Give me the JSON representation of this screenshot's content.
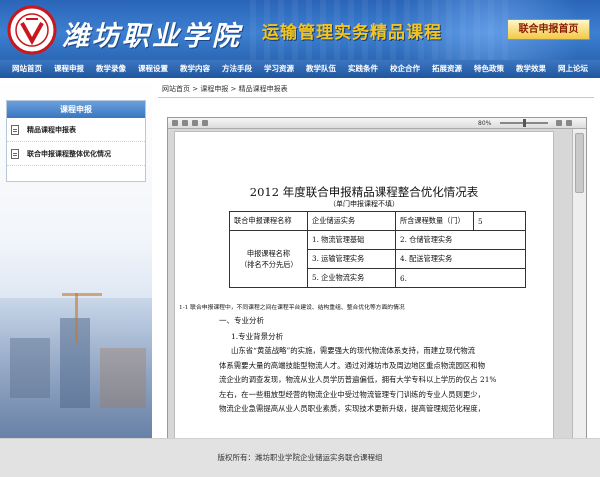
{
  "header": {
    "school_name": "潍坊职业学院",
    "course_title": "运输管理实务精品课程",
    "apply_button": "联合申报首页"
  },
  "nav": [
    "网站首页",
    "课程申报",
    "教学录像",
    "课程设置",
    "教学内容",
    "方法手段",
    "学习资源",
    "教学队伍",
    "实践条件",
    "校企合作",
    "拓展资源",
    "特色政策",
    "教学效果",
    "网上论坛"
  ],
  "sidebar": {
    "title": "课程申报",
    "items": [
      {
        "label": "精品课程申报表",
        "icon": "document-icon"
      },
      {
        "label": "联合申报课程整体优化情况",
        "icon": "document-icon"
      }
    ]
  },
  "breadcrumb": "网站首页 > 课程申报 > 精品课程申报表",
  "viewer": {
    "zoom": "80%",
    "doc_title": "2012 年度联合申报精品课程整合优化情况表",
    "doc_subtitle": "（单门申报课程不填）",
    "table": {
      "r1": [
        "联合申报课程名称",
        "企业储运实务",
        "所含课程数量（门）",
        "5"
      ],
      "group_label": "申报课程名称（排名不分先后）",
      "courses": [
        "1. 物流管理基础",
        "2. 仓储管理实务",
        "3. 运输管理实务",
        "4. 配送管理实务",
        "5. 企业物流实务",
        "6."
      ]
    },
    "note": "1-1 联合申报课程中，不同课程之间在课程平台建设、结构重组、整合优化等方面的情况",
    "section1": "一、专业分析",
    "section2": "1.专业背景分析",
    "paragraph": [
      "山东省“黄蓝战略”的实施，需要强大的现代物流体系支持，而建立现代物流",
      "体系需要大量的高端技能型物流人才。通过对潍坊市及周边地区重点物流园区和物",
      "流企业的调查发现，物流从业人员学历普遍偏低，拥有大学专科以上学历的仅占 21%",
      "左右，在一些粗放型经营的物流企业中受过物流管理专门训练的专业人员则更少，",
      "物流企业急需提高从业人员职业素质，实现技术更新升级，提高管理规范化程度，"
    ]
  },
  "footer": "版权所有：潍坊职业学院企业储运实务联合课程组",
  "colors": {
    "nav": "#2a62ad",
    "accent_gold": "#f3c41f",
    "header_blue": "#3d7fd0"
  }
}
